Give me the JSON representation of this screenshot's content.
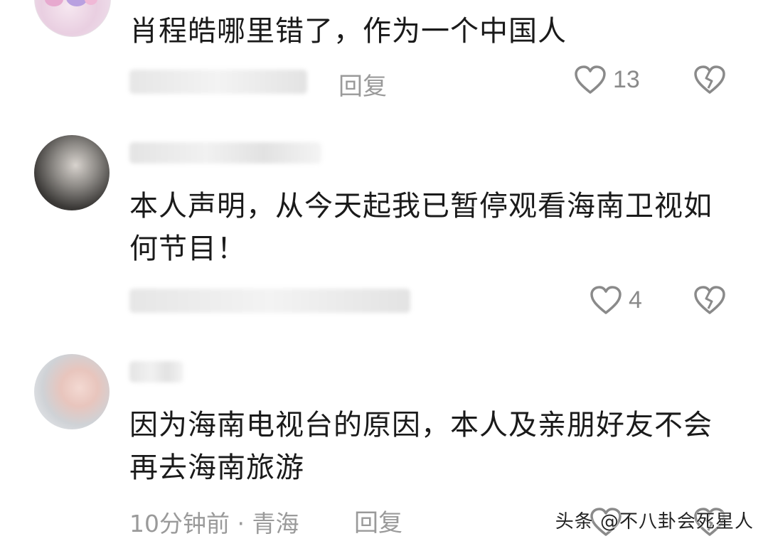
{
  "comments": [
    {
      "text": "肖程皓哪里错了，作为一个中国人",
      "reply": "回复",
      "likes": "13"
    },
    {
      "text": "本人声明，从今天起我已暂停观看海南卫视如何节目！",
      "reply": "",
      "likes": "4"
    },
    {
      "text": "因为海南电视台的原因，本人及亲朋好友不会再去海南旅游",
      "meta": "10分钟前 · 青海",
      "reply": "回复",
      "likes": ""
    }
  ],
  "watermark": "头条 @不八卦会死星人",
  "icons": {
    "like": "heart-outline-icon",
    "dislike": "broken-heart-icon"
  },
  "colors": {
    "text": "#1a1a1a",
    "meta": "#9a9a9a",
    "icon": "#8a8a8a"
  }
}
